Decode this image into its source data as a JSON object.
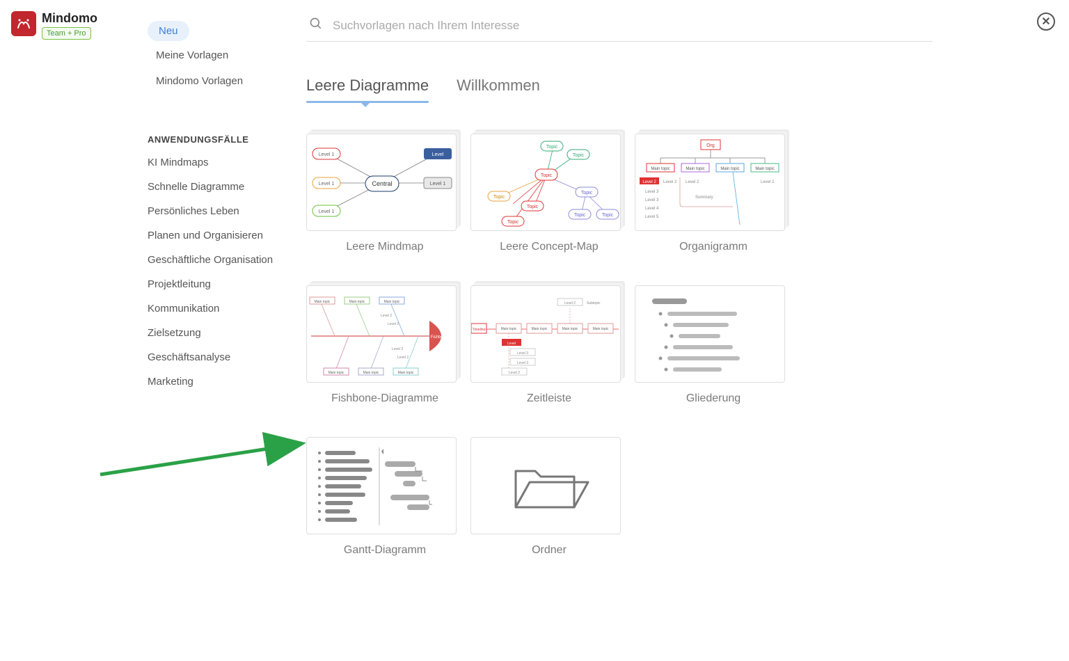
{
  "brand": {
    "name": "Mindomo",
    "badge": "Team + Pro"
  },
  "close_label": "✕",
  "sidebar": {
    "group1": [
      {
        "label": "Neu",
        "active": true
      },
      {
        "label": "Meine Vorlagen",
        "active": false
      },
      {
        "label": "Mindomo Vorlagen",
        "active": false
      }
    ],
    "section_title": "ANWENDUNGSFÄLLE",
    "use_cases": [
      "KI Mindmaps",
      "Schnelle Diagramme",
      "Persönliches Leben",
      "Planen und Organisieren",
      "Geschäftliche Organisation",
      "Projektleitung",
      "Kommunikation",
      "Zielsetzung",
      "Geschäftsanalyse",
      "Marketing"
    ]
  },
  "search": {
    "placeholder": "Suchvorlagen nach Ihrem Interesse"
  },
  "tabs": [
    {
      "label": "Leere Diagramme",
      "active": true
    },
    {
      "label": "Willkommen",
      "active": false
    }
  ],
  "templates": [
    {
      "label": "Leere Mindmap",
      "thumb": "mindmap"
    },
    {
      "label": "Leere Concept-Map",
      "thumb": "concept"
    },
    {
      "label": "Organigramm",
      "thumb": "org"
    },
    {
      "label": "Fishbone-Diagramme",
      "thumb": "fishbone"
    },
    {
      "label": "Zeitleiste",
      "thumb": "timeline"
    },
    {
      "label": "Gliederung",
      "thumb": "outline"
    },
    {
      "label": "Gantt-Diagramm",
      "thumb": "gantt"
    },
    {
      "label": "Ordner",
      "thumb": "folder"
    }
  ],
  "thumb_text": {
    "central": "Central",
    "level1": "Level 1",
    "level": "Level",
    "topic": "Topic",
    "org": "Org",
    "main_topic": "Main topic",
    "level2": "Level 2",
    "level3": "Level 3",
    "level4": "Level 4",
    "level5": "Level 5",
    "summary": "Summary",
    "fishbone": "Fishbone",
    "timeline": "Timeline",
    "subtopic": "Subtopic"
  },
  "colors": {
    "accent_blue": "#8bb8e8",
    "arrow_green": "#2aa147",
    "brand_red": "#c1272d"
  }
}
